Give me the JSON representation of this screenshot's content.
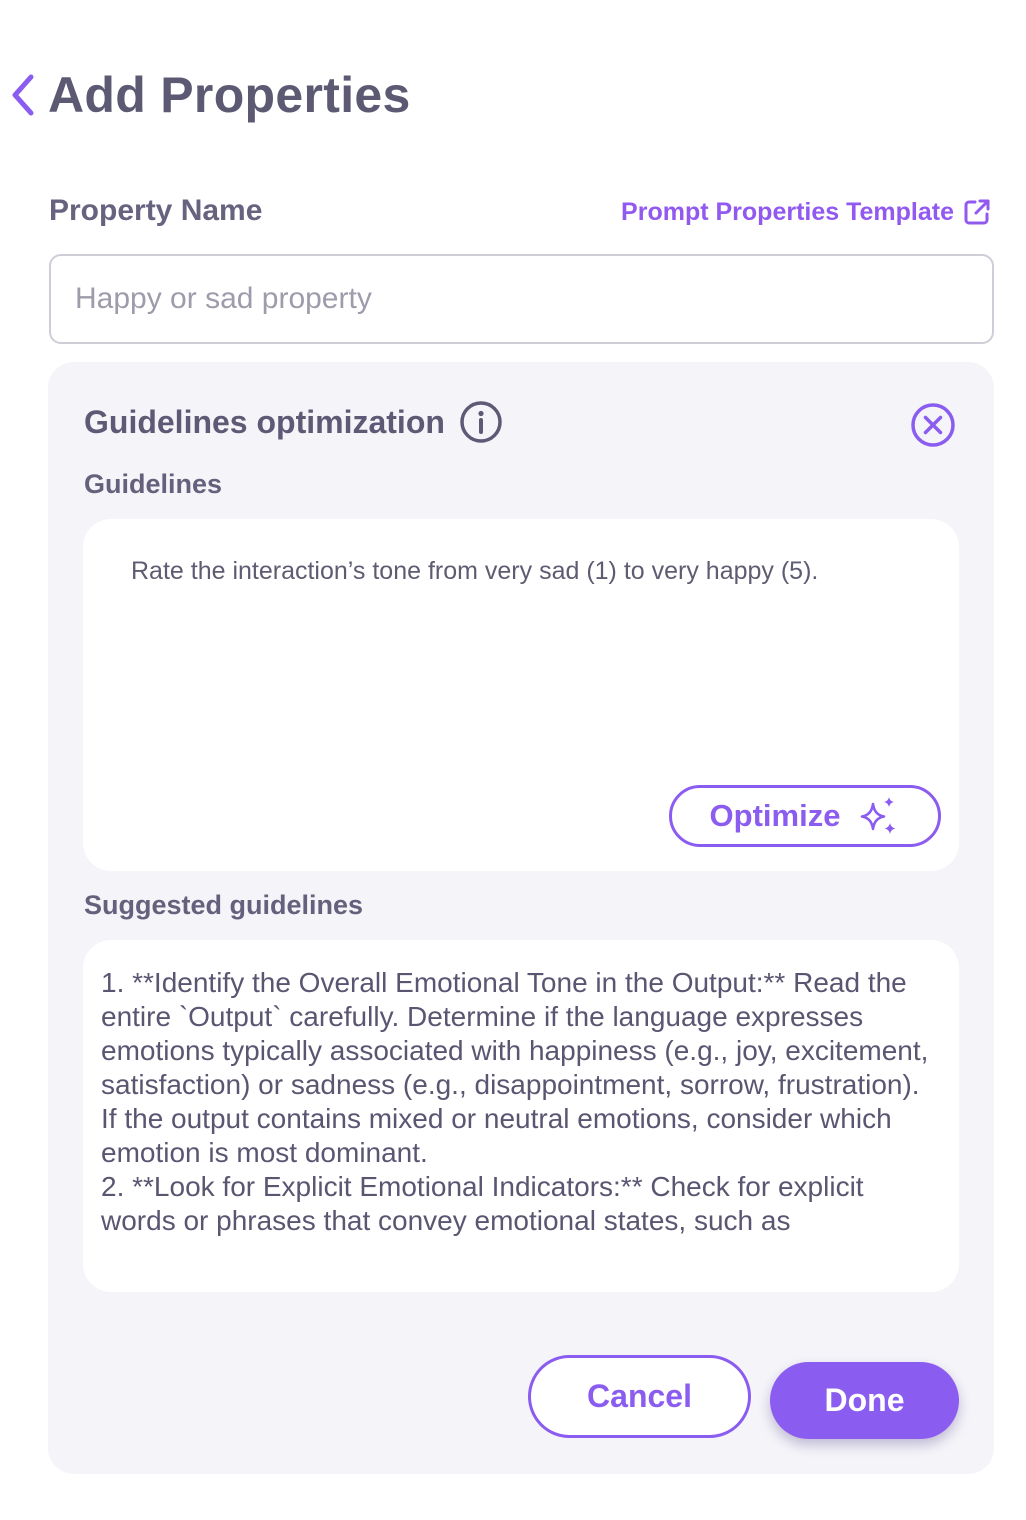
{
  "header": {
    "title": "Add Properties",
    "back_icon": "chevron-left-icon"
  },
  "property": {
    "label": "Property Name",
    "template_link": "Prompt Properties Template",
    "input_value": "",
    "input_placeholder": "Happy or sad property"
  },
  "panel": {
    "title": "Guidelines optimization",
    "guidelines_label": "Guidelines",
    "guidelines_text": "Rate the interaction’s tone from very sad (1) to very happy (5).",
    "optimize_label": "Optimize",
    "suggested_label": "Suggested guidelines",
    "suggested_text": "1. **Identify the Overall Emotional Tone in the Output:** Read the entire `Output` carefully. Determine if the language expresses emotions typically associated with happiness (e.g., joy, excitement, satisfaction) or sadness (e.g., disappointment, sorrow, frustration). If the output contains mixed or neutral emotions, consider which emotion is most dominant.\n2. **Look for Explicit Emotional Indicators:** Check for explicit words or phrases that convey emotional states, such as"
  },
  "actions": {
    "cancel_label": "Cancel",
    "done_label": "Done"
  },
  "colors": {
    "accent": "#8b5cf0",
    "panel_bg": "#f4f4f9",
    "text": "#5c5a73"
  }
}
